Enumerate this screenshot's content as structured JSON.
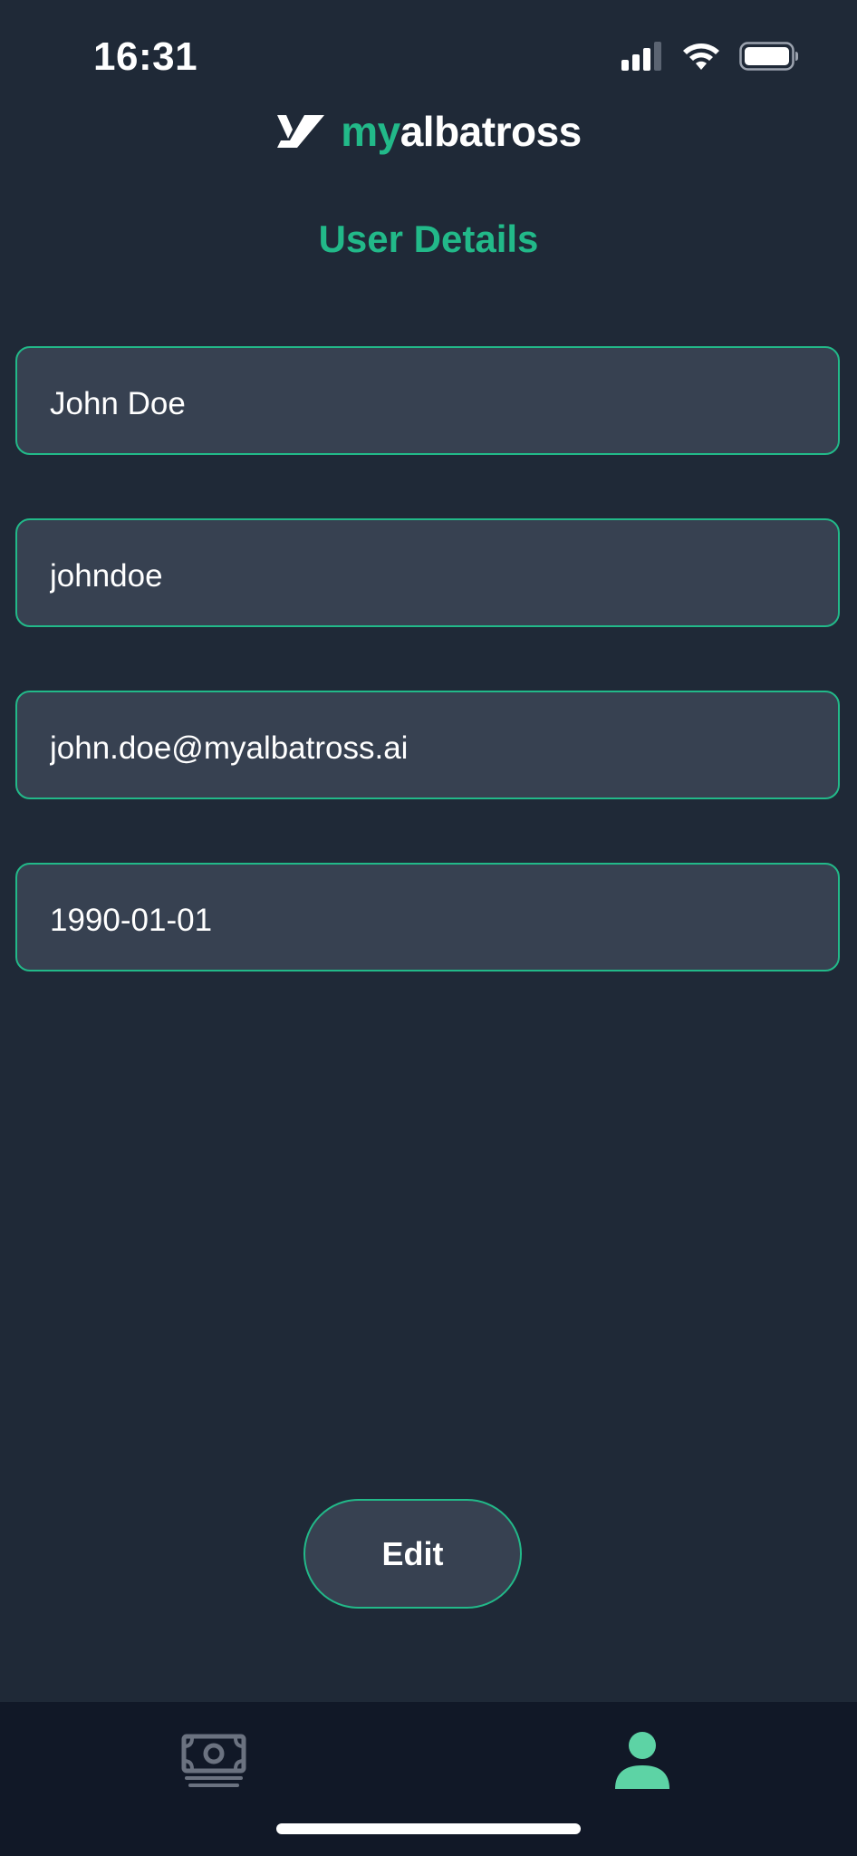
{
  "status_bar": {
    "time": "16:31"
  },
  "header": {
    "brand_accent": "my",
    "brand_rest": "albatross",
    "logo_icon": "albatross-logo-icon"
  },
  "page": {
    "title": "User Details"
  },
  "fields": {
    "full_name": "John Doe",
    "username": "johndoe",
    "email": "john.doe@myalbatross.ai",
    "birthdate": "1990-01-01"
  },
  "actions": {
    "edit_label": "Edit"
  },
  "tab_bar": {
    "tabs": [
      {
        "icon": "money-icon",
        "active": false
      },
      {
        "icon": "user-icon",
        "active": true
      }
    ]
  },
  "colors": {
    "background": "#1f2937",
    "field_background": "#374151",
    "accent": "#22b989",
    "tab_bar_background": "#111827",
    "inactive_icon": "#6b7280",
    "active_icon": "#5dd3a5"
  }
}
